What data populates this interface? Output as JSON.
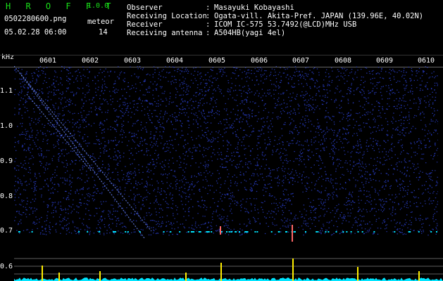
{
  "header": {
    "app_title": "H R O F F T",
    "app_version": "1.0.0",
    "file_name": "0502280600.png",
    "date_time": "05.02.28 06:00",
    "meteor_label": "meteor",
    "meteor_count": "14"
  },
  "info": [
    {
      "key": "Observer",
      "value": "Masayuki Kobayashi"
    },
    {
      "key": "Receiving Location",
      "value": "Ogata-vill. Akita-Pref. JAPAN (139.96E, 40.02N)"
    },
    {
      "key": "Receiver",
      "value": "ICOM IC-575 53.7492(@LCD)MHz USB"
    },
    {
      "key": "Receiving antenna",
      "value": "A504HB(yagi 4el)"
    }
  ],
  "axis": {
    "unit": "kHz",
    "time_labels": [
      "0601",
      "0602",
      "0603",
      "0604",
      "0605",
      "0606",
      "0607",
      "0608",
      "0609",
      "0610"
    ],
    "freq_labels": [
      "1.1",
      "1.0",
      "0.9",
      "0.8",
      "0.7",
      "0.6"
    ]
  },
  "colors": {
    "title_green": "#19e019",
    "noise_blue": "#2a3fd0",
    "trace_cyan": "#00e5ff",
    "spike_yellow": "#ffee00"
  }
}
